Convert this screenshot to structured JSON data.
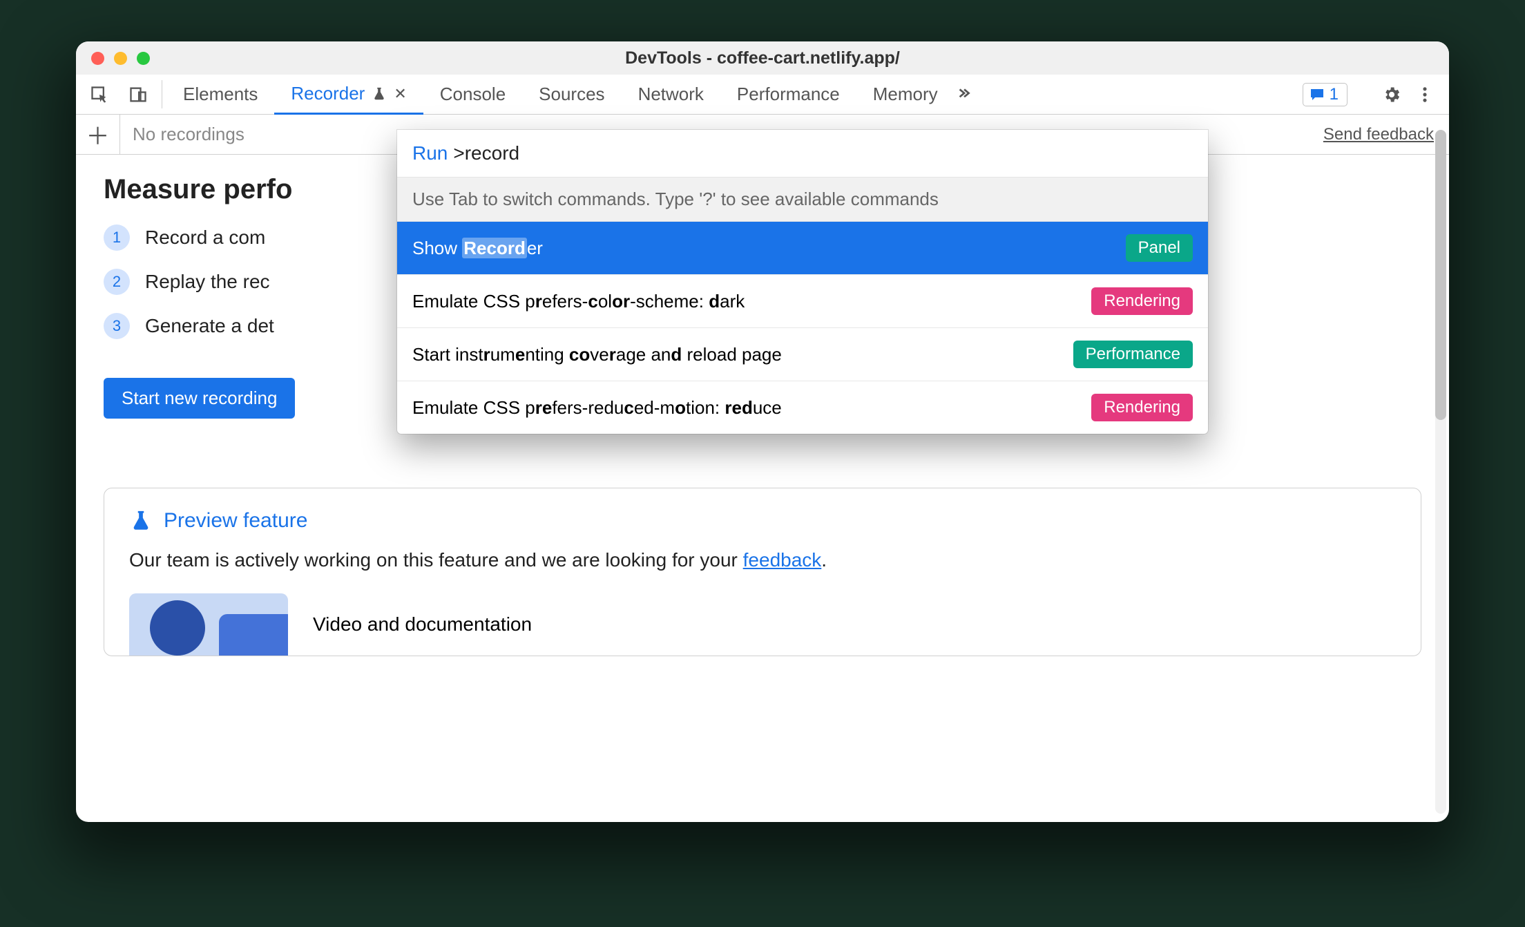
{
  "titlebar": {
    "title": "DevTools - coffee-cart.netlify.app/"
  },
  "tabs": {
    "items": [
      "Elements",
      "Recorder",
      "Console",
      "Sources",
      "Network",
      "Performance",
      "Memory"
    ],
    "activeIndex": 1
  },
  "msgBadge": {
    "count": "1"
  },
  "toolbar": {
    "no_recordings": "No recordings",
    "send_feedback": "Send feedback"
  },
  "content": {
    "heading": "Measure perfo",
    "steps": [
      "Record a com",
      "Replay the rec",
      "Generate a det"
    ],
    "start_btn": "Start new recording"
  },
  "preview": {
    "title": "Preview feature",
    "body_pre": "Our team is actively working on this feature and we are looking for your ",
    "body_link": "feedback",
    "body_post": ".",
    "video_label": "Video and documentation"
  },
  "palette": {
    "run_label": "Run",
    "query": ">record",
    "hint": "Use Tab to switch commands. Type '?' to see available commands",
    "items": [
      {
        "label_html": "Show <span class='hl'><b>Record</b></span>er",
        "badge": "Panel",
        "badgeClass": "panel",
        "selected": true
      },
      {
        "label_html": "Emulate CSS p<b>r</b>efers-<b>c</b>ol<b>or</b>-scheme: <b>d</b>ark",
        "badge": "Rendering",
        "badgeClass": "rendering",
        "selected": false
      },
      {
        "label_html": "Start inst<b>r</b>um<b>e</b>nting <b>co</b>ve<b>r</b>age an<b>d</b> reload page",
        "badge": "Performance",
        "badgeClass": "perf",
        "selected": false
      },
      {
        "label_html": "Emulate CSS p<b>re</b>fers-redu<b>c</b>ed-m<b>o</b>tion: <b>red</b>uce",
        "badge": "Rendering",
        "badgeClass": "rendering",
        "selected": false
      }
    ]
  }
}
